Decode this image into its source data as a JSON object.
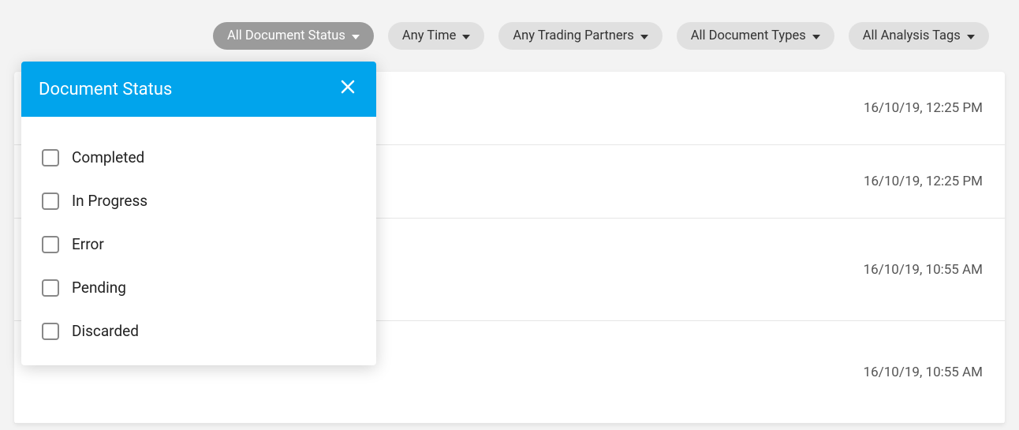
{
  "filters": {
    "document_status": "All Document Status",
    "time": "Any Time",
    "trading_partners": "Any Trading Partners",
    "document_types": "All Document Types",
    "analysis_tags": "All Analysis Tags"
  },
  "dropdown": {
    "title": "Document Status",
    "options": {
      "0": "Completed",
      "1": "In Progress",
      "2": "Error",
      "3": "Pending",
      "4": "Discarded"
    }
  },
  "rows": {
    "0": {
      "timestamp": "16/10/19, 12:25 PM"
    },
    "1": {
      "timestamp": "16/10/19, 12:25 PM"
    },
    "2": {
      "timestamp": "16/10/19, 10:55 AM"
    },
    "3": {
      "timestamp": "16/10/19, 10:55 AM"
    }
  }
}
